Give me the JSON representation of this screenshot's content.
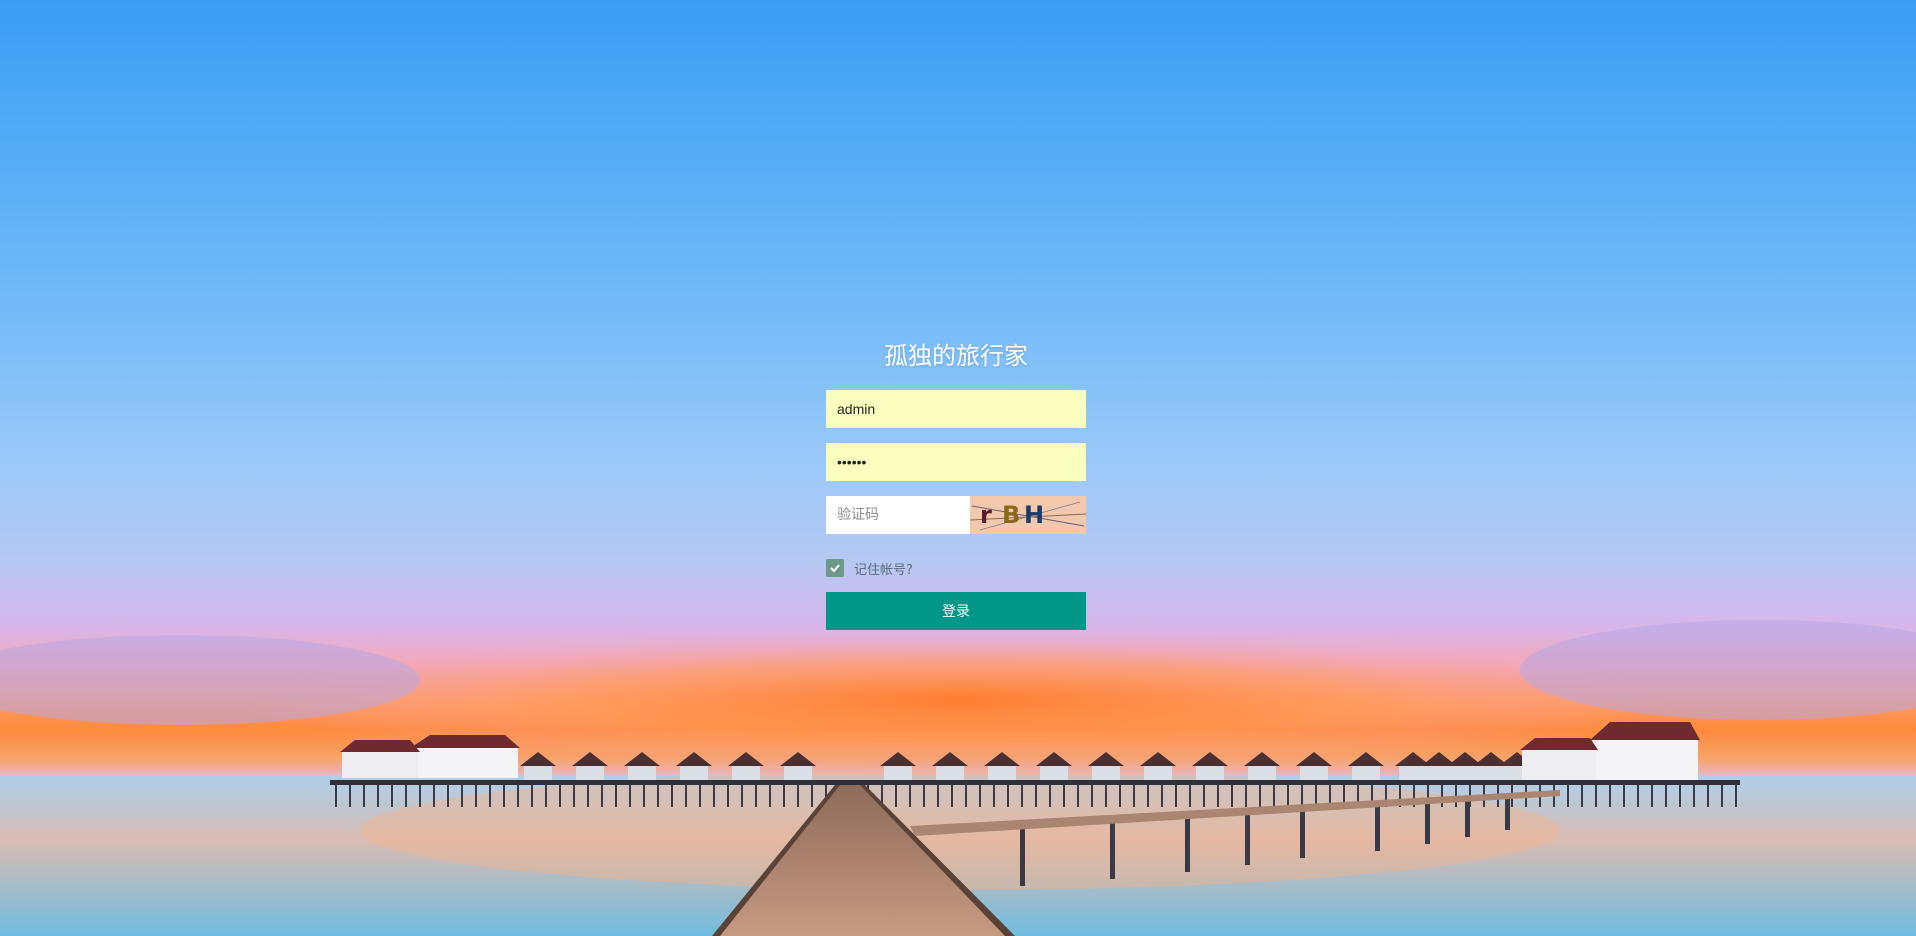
{
  "login": {
    "title": "孤独的旅行家",
    "username_value": "admin",
    "password_value": "••••••",
    "captcha_placeholder": "验证码",
    "captcha_text": "rBH",
    "remember_label": "记住帐号?",
    "remember_checked": true,
    "submit_label": "登录"
  },
  "colors": {
    "autofill_bg": "#faffbd",
    "button_bg": "#009688",
    "checkbox_bg": "#6b9a8a"
  }
}
